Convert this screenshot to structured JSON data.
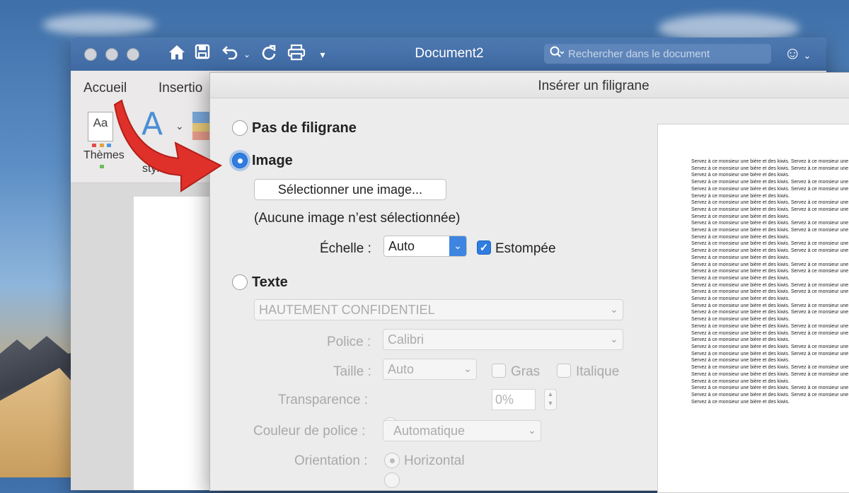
{
  "window": {
    "title": "Document2",
    "search_placeholder": "Rechercher dans le document"
  },
  "ribbon": {
    "tabs": [
      "Accueil",
      "Insertio"
    ],
    "themes_label": "Thèmes",
    "theme_icon_text": "Aa",
    "styles_label": "styles"
  },
  "dialog": {
    "title": "Insérer un filigrane",
    "no_watermark": "Pas de filigrane",
    "image_option": "Image",
    "select_image_button": "Sélectionner une image...",
    "no_image_text": "(Aucune image n’est sélectionnée)",
    "scale_label": "Échelle :",
    "scale_value": "Auto",
    "washout_label": "Estompée",
    "washout_checked": true,
    "text_option": "Texte",
    "text_value": "HAUTEMENT CONFIDENTIEL",
    "font_label": "Police :",
    "font_value": "Calibri",
    "size_label": "Taille :",
    "size_value": "Auto",
    "bold_label": "Gras",
    "italic_label": "Italique",
    "transparency_label": "Transparence :",
    "transparency_value": "0%",
    "font_color_label": "Couleur de police :",
    "font_color_value": "Automatique",
    "orientation_label": "Orientation :",
    "orientation_horizontal": "Horizontal",
    "selected_option": "Image"
  },
  "preview": {
    "line_a": "Servez à ce monsieur une bière et des kiwis. Servez à ce monsieur une bière et des kiwis.",
    "line_b": "Servez à ce monsieur une bière et des kiwis."
  },
  "colors": {
    "titlebar": "#4a74ad",
    "accent": "#2f7de1",
    "annotation_arrow": "#e0302a"
  }
}
